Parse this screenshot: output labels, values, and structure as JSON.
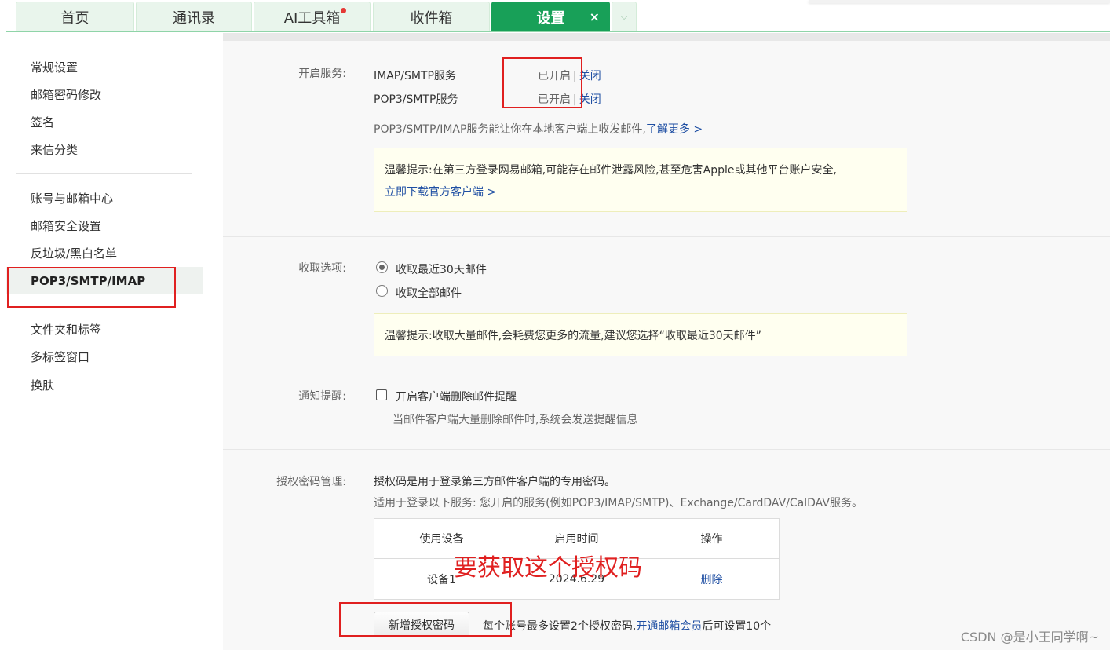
{
  "tabs": [
    {
      "label": "首页"
    },
    {
      "label": "通讯录"
    },
    {
      "label": "AI工具箱"
    },
    {
      "label": "收件箱"
    },
    {
      "label": "设置"
    }
  ],
  "tab_close": "×",
  "tab_more": "⌵",
  "sidebar": {
    "items": [
      {
        "label": "常规设置"
      },
      {
        "label": "邮箱密码修改"
      },
      {
        "label": "签名"
      },
      {
        "label": "来信分类"
      },
      {
        "label": "账号与邮箱中心"
      },
      {
        "label": "邮箱安全设置"
      },
      {
        "label": "反垃圾/黑白名单"
      },
      {
        "label": "POP3/SMTP/IMAP"
      },
      {
        "label": "文件夹和标签"
      },
      {
        "label": "多标签窗口"
      },
      {
        "label": "换肤"
      }
    ]
  },
  "services": {
    "label": "开启服务:",
    "rows": [
      {
        "name": "IMAP/SMTP服务",
        "status": "已开启",
        "sep": "|",
        "action": "关闭"
      },
      {
        "name": "POP3/SMTP服务",
        "status": "已开启",
        "sep": "|",
        "action": "关闭"
      }
    ],
    "desc": "POP3/SMTP/IMAP服务能让你在本地客户端上收发邮件,",
    "learn_more": "了解更多 >",
    "notice_line1": "温馨提示:在第三方登录网易邮箱,可能存在邮件泄露风险,甚至危害Apple或其他平台账户安全,",
    "notice_link": "立即下载官方客户端 >"
  },
  "receive": {
    "label": "收取选项:",
    "options": [
      {
        "label": "收取最近30天邮件",
        "checked": true
      },
      {
        "label": "收取全部邮件",
        "checked": false
      }
    ],
    "notice": "温馨提示:收取大量邮件,会耗费您更多的流量,建议您选择“收取最近30天邮件”"
  },
  "notify": {
    "label": "通知提醒:",
    "checkbox_label": "开启客户端删除邮件提醒",
    "checked": false,
    "desc": "当邮件客户端大量删除邮件时,系统会发送提醒信息"
  },
  "auth": {
    "label": "授权密码管理:",
    "desc1": "授权码是用于登录第三方邮件客户端的专用密码。",
    "desc2": "适用于登录以下服务: 您开启的服务(例如POP3/IMAP/SMTP)、Exchange/CardDAV/CalDAV服务。",
    "table": {
      "headers": [
        "使用设备",
        "启用时间",
        "操作"
      ],
      "rows": [
        {
          "device": "设备1",
          "time": "2024.6.29",
          "action": "删除"
        }
      ]
    },
    "add_button": "新增授权密码",
    "limit_text": "每个账号最多设置2个授权密码,",
    "vip_link": "开通邮箱会员",
    "limit_suffix": "后可设置10个"
  },
  "annotation": {
    "text": "要获取这个授权码"
  },
  "watermark": "CSDN @是小王同学啊~",
  "colors": {
    "accent": "#18a058",
    "link": "#1f4fa3",
    "annotation": "#e02020",
    "notice_bg": "#fffff0"
  }
}
